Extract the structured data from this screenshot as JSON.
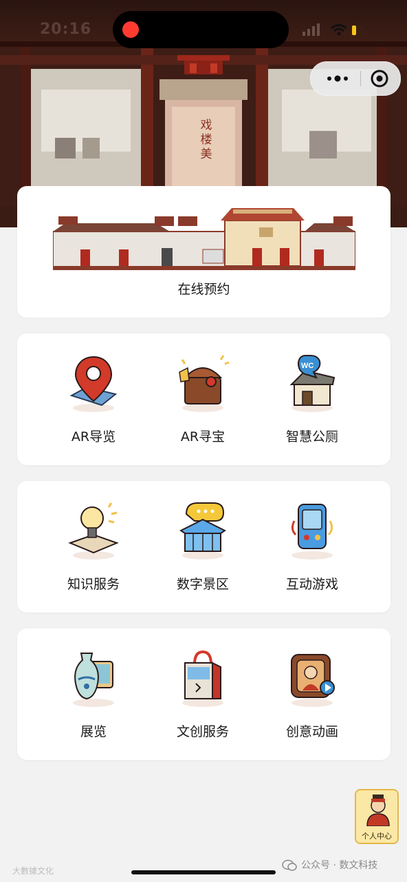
{
  "status_bar": {
    "time": "20:16"
  },
  "hero": {
    "plaque_text": "戏楼美"
  },
  "booking": {
    "label": "在线预约"
  },
  "grid_rows": [
    [
      {
        "label": "AR导览",
        "icon": "map-pin-icon"
      },
      {
        "label": "AR寻宝",
        "icon": "treasure-chest-icon"
      },
      {
        "label": "智慧公厕",
        "icon": "wc-house-icon"
      }
    ],
    [
      {
        "label": "知识服务",
        "icon": "lightbulb-book-icon"
      },
      {
        "label": "数字景区",
        "icon": "pavilion-icon"
      },
      {
        "label": "互动游戏",
        "icon": "game-console-icon"
      }
    ],
    [
      {
        "label": "展览",
        "icon": "vase-icon"
      },
      {
        "label": "文创服务",
        "icon": "gift-bag-icon"
      },
      {
        "label": "创意动画",
        "icon": "animation-player-icon"
      }
    ]
  ],
  "wc_badge": "WC",
  "personal_center": {
    "label": "个人中心"
  },
  "watermark": {
    "left": "大數據文化",
    "right": "公众号 · 数文科技"
  },
  "colors": {
    "accent_red": "#c0392b",
    "background": "#f2f2f2",
    "card": "#ffffff",
    "personal_bg": "#fbe8a6"
  }
}
